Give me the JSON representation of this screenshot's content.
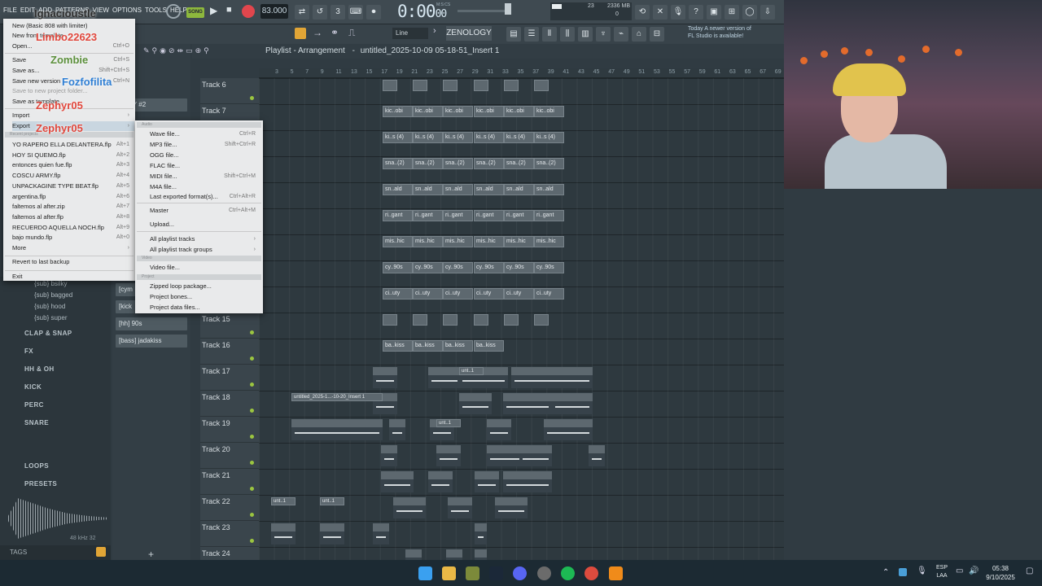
{
  "menubar": {
    "items": [
      "FILE",
      "EDIT",
      "ADD",
      "PATTERNS",
      "VIEW",
      "OPTIONS",
      "TOOLS",
      "HELP"
    ]
  },
  "transport": {
    "mode": "SONG",
    "tempo": "83.000",
    "time": "0:00",
    "time_frac": "00",
    "time_label": "M:S:CS",
    "memory": "2336 MB",
    "cpu": "23",
    "voices": "0"
  },
  "toolbar": {
    "snap": "Line",
    "plugin": "ZENOLOGY"
  },
  "news": {
    "line1": "Today  A newer version of",
    "line2": "FL Studio is available!"
  },
  "playlist": {
    "title": "Playlist - Arrangement",
    "breadcrumb": "untitled_2025-10-09 05-18-51_Insert 1"
  },
  "ruler": [
    "3",
    "5",
    "7",
    "9",
    "11",
    "13",
    "15",
    "17",
    "19",
    "21",
    "23",
    "25",
    "27",
    "29",
    "31",
    "33",
    "35",
    "37",
    "39",
    "41",
    "43",
    "45",
    "47",
    "49",
    "51",
    "53",
    "55",
    "57",
    "59",
    "61",
    "63",
    "65",
    "67",
    "69"
  ],
  "tracks": [
    "Track 6",
    "Track 7",
    "",
    "",
    "",
    "",
    "",
    "",
    "",
    "Track 15",
    "Track 16",
    "Track 17",
    "Track 18",
    "Track 19",
    "Track 20",
    "Track 21",
    "Track 22",
    "Track 23",
    "Track 24"
  ],
  "clip_labels": {
    "row7": "kic..obi",
    "row8": "ki..s (4)",
    "row9": "sna..(2)",
    "row10": "sn..ald",
    "row11": "ri..gant",
    "row12": "mis..hic",
    "row13": "cy..90s",
    "row14": "ci..uty",
    "row16": "ba..kiss",
    "row17": "unt..1",
    "row18": "untitled_2025-1...-10-20_Insert 1",
    "row19": "unt..1",
    "row22": "unt..1"
  },
  "channels": [
    "LOGY #2",
    "[cym",
    "[kick",
    "[hh] 90s",
    "[bass] jadakiss"
  ],
  "browser": {
    "items": [
      "{sub} bsilky",
      "{sub} bagged",
      "{sub} hood",
      "{sub} super"
    ],
    "folders": [
      "CLAP & SNAP",
      "FX",
      "HH & OH",
      "KICK",
      "PERC",
      "SNARE",
      "LOOPS",
      "PRESETS"
    ],
    "sample_info": "48 kHz 32",
    "tags_label": "TAGS"
  },
  "file_menu": {
    "items": [
      {
        "label": "New (Basic 808 with limiter)",
        "shortcut": ""
      },
      {
        "label": "New from template",
        "shortcut": ""
      },
      {
        "label": "Open...",
        "shortcut": "Ctrl+O"
      },
      {
        "label": "Save",
        "shortcut": "Ctrl+S"
      },
      {
        "label": "Save as...",
        "shortcut": "Shift+Ctrl+S"
      },
      {
        "label": "Save new version",
        "shortcut": "Ctrl+N"
      },
      {
        "label": "Save to new project folder...",
        "shortcut": ""
      },
      {
        "label": "Save as template...",
        "shortcut": ""
      },
      {
        "label": "Import",
        "shortcut": ""
      },
      {
        "label": "Export",
        "shortcut": ""
      }
    ],
    "recent_header": "Recent projects",
    "recent": [
      {
        "label": "YO RAPERO ELLA DELANTERA.flp",
        "shortcut": "Alt+1"
      },
      {
        "label": "HOY SI QUEMO.flp",
        "shortcut": "Alt+2"
      },
      {
        "label": "entonces quien fue.flp",
        "shortcut": "Alt+3"
      },
      {
        "label": "COSCU ARMY.flp",
        "shortcut": "Alt+4"
      },
      {
        "label": "UNPACKAGINE TYPE BEAT.flp",
        "shortcut": "Alt+5"
      },
      {
        "label": "argentina.flp",
        "shortcut": "Alt+6"
      },
      {
        "label": "faltemos al after.zip",
        "shortcut": "Alt+7"
      },
      {
        "label": "faltemos al after.flp",
        "shortcut": "Alt+8"
      },
      {
        "label": "RECUERDO AQUELLA NOCH.flp",
        "shortcut": "Alt+9"
      },
      {
        "label": "bajo mundo.flp",
        "shortcut": "Alt+0"
      },
      {
        "label": "More",
        "shortcut": ""
      }
    ],
    "revert": "Revert to last backup",
    "exit": "Exit"
  },
  "export_menu": {
    "audio_header": "Audio",
    "audio": [
      {
        "label": "Wave file...",
        "shortcut": "Ctrl+R"
      },
      {
        "label": "MP3 file...",
        "shortcut": "Shift+Ctrl+R"
      },
      {
        "label": "OGG file...",
        "shortcut": ""
      },
      {
        "label": "FLAC file...",
        "shortcut": ""
      },
      {
        "label": "MIDI file...",
        "shortcut": "Shift+Ctrl+M"
      },
      {
        "label": "M4A file...",
        "shortcut": ""
      },
      {
        "label": "Last exported format(s)...",
        "shortcut": "Ctrl+Alt+R"
      },
      {
        "label": "Master",
        "shortcut": "Ctrl+Alt+M"
      },
      {
        "label": "Upload...",
        "shortcut": ""
      },
      {
        "label": "All playlist tracks",
        "shortcut": ""
      },
      {
        "label": "All playlist track groups",
        "shortcut": ""
      }
    ],
    "video_header": "Video",
    "video": [
      {
        "label": "Video file...",
        "shortcut": ""
      }
    ],
    "project_header": "Project",
    "project": [
      {
        "label": "Zipped loop package...",
        "shortcut": ""
      },
      {
        "label": "Project bones...",
        "shortcut": ""
      },
      {
        "label": "Project data files...",
        "shortcut": ""
      }
    ]
  },
  "overlay_names": [
    "Ignacioustle",
    "Limbo22623",
    "Zombie",
    "Fozfofilita",
    "Zephyr05",
    "Zephyr05"
  ],
  "system_tray": {
    "lang1": "ESP",
    "lang2": "LAA",
    "time": "05:38",
    "date": "9/10/2025"
  },
  "colors": {
    "accent_green": "#9bc540",
    "record_red": "#e1464d",
    "menu_bg": "#e9eaeb",
    "panel_bg": "#303b42"
  }
}
